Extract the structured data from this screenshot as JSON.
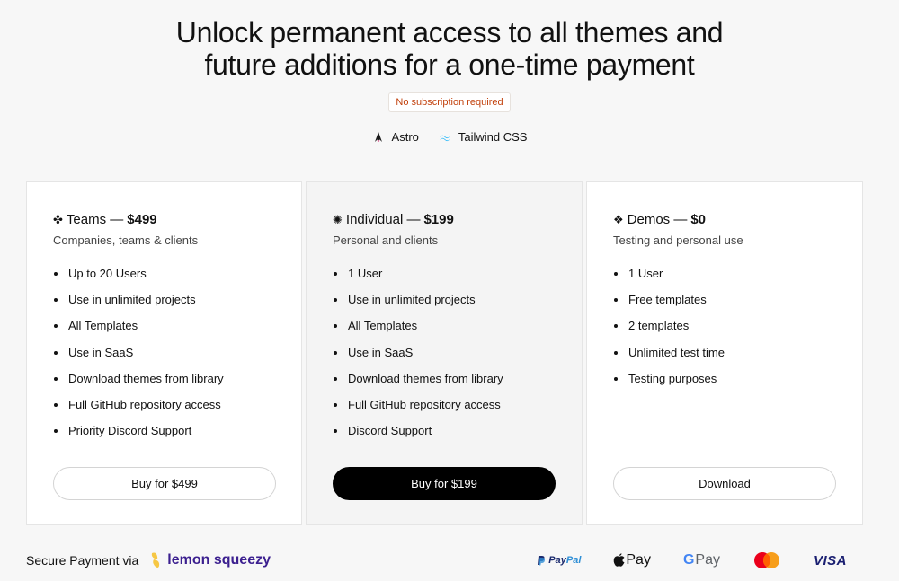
{
  "headline": {
    "line1": "Unlock permanent access to all themes and",
    "line2": "future additions for a one-time payment"
  },
  "badge": "No subscription required",
  "tech": [
    {
      "icon": "astro-icon",
      "label": "Astro"
    },
    {
      "icon": "tailwind-icon",
      "label": "Tailwind CSS"
    }
  ],
  "plans": [
    {
      "symbol": "✤",
      "name": "Teams —",
      "price": "$499",
      "subtitle": "Companies, teams & clients",
      "features": [
        "Up to 20 Users",
        "Use in unlimited projects",
        "All Templates",
        "Use in SaaS",
        "Download themes from library",
        "Full GitHub repository access",
        "Priority Discord Support"
      ],
      "button": "Buy for $499"
    },
    {
      "symbol": "✺",
      "name": "Individual —",
      "price": "$199",
      "subtitle": "Personal and clients",
      "features": [
        "1 User",
        "Use in unlimited projects",
        "All Templates",
        "Use in SaaS",
        "Download themes from library",
        "Full GitHub repository access",
        "Discord Support"
      ],
      "button": "Buy for $199"
    },
    {
      "symbol": "❖",
      "name": "Demos —",
      "price": "$0",
      "subtitle": "Testing and personal use",
      "features": [
        "1 User",
        "Free templates",
        "2 templates",
        "Unlimited test time",
        "Testing purposes"
      ],
      "button": "Download"
    }
  ],
  "footer": {
    "secure_text": "Secure Payment via",
    "brand": "lemon squeezy",
    "payments": {
      "paypal_a": "Pay",
      "paypal_b": "Pal",
      "apple_pay": "Pay",
      "google_pay_g": "G",
      "google_pay": "Pay",
      "visa": "VISA"
    }
  },
  "colors": {
    "badge_text": "#c2410c",
    "dark_button": "#000000",
    "lemon_brand": "#3b1f8f"
  }
}
